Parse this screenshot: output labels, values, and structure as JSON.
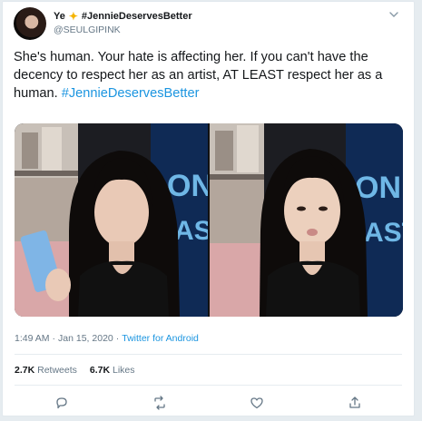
{
  "tweet": {
    "display_name": "Ye",
    "name_hashtag": "#JennieDeservesBetter",
    "handle": "@SEULGIPINK",
    "text_main": "She's human. Your hate is affecting her. If you can't have the decency to respect her as an artist, AT LEAST respect her as a human.",
    "text_hashtag": "#JennieDeservesBetter",
    "time": "1:49 AM",
    "date": "Jan 15, 2020",
    "separator": "·",
    "source": "Twitter for Android",
    "retweets_count": "2.7K",
    "retweets_label": "Retweets",
    "likes_count": "6.7K",
    "likes_label": "Likes",
    "media_sign_left": "ON",
    "media_sign_left_2": "AST",
    "media_sign_right": "ON",
    "media_sign_right_2": "AST"
  },
  "icons": {
    "menu": "chevron-down-icon",
    "reply": "reply-icon",
    "retweet": "retweet-icon",
    "like": "heart-icon",
    "share": "share-icon",
    "badge": "sparkle-icon"
  },
  "colors": {
    "link": "#1b95e0",
    "secondary_text": "#657786",
    "text": "#14171a",
    "badge": "#f5b400"
  }
}
